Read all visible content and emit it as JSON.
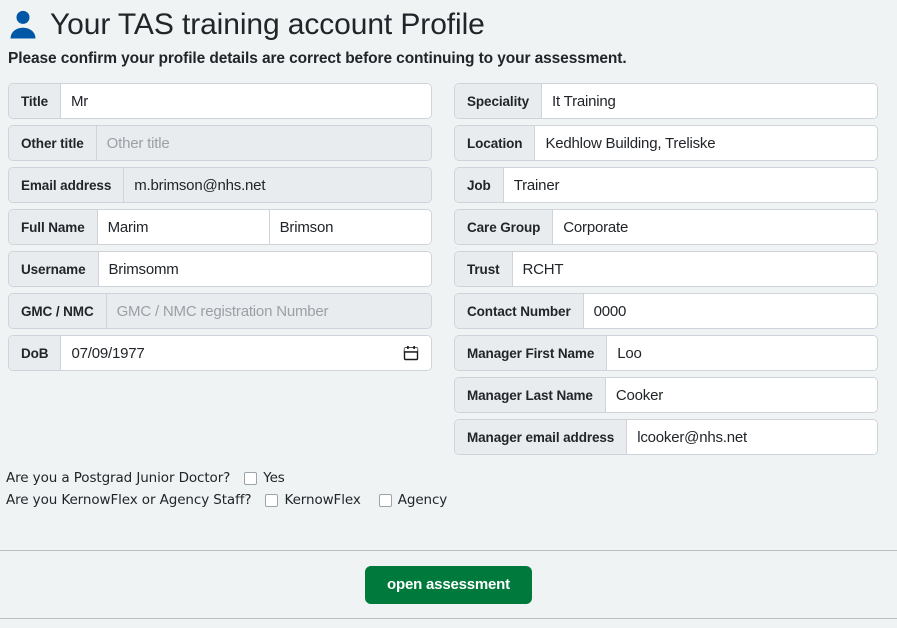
{
  "header": {
    "icon": "person-icon",
    "title": "Your TAS training account Profile",
    "subtitle": "Please confirm your profile details are correct before continuing to your assessment."
  },
  "form": {
    "left_column": [
      {
        "name": "title",
        "label": "Title",
        "value": "Mr",
        "placeholder": "",
        "readonly": false
      },
      {
        "name": "other-title",
        "label": "Other title",
        "value": "",
        "placeholder": "Other title",
        "readonly": true
      },
      {
        "name": "email",
        "label": "Email address",
        "value": "m.brimson@nhs.net",
        "placeholder": "",
        "readonly": true
      },
      {
        "name": "full-name",
        "label": "Full Name",
        "value": "Marim",
        "value2": "Brimson",
        "placeholder": "",
        "readonly": false,
        "split": true
      },
      {
        "name": "username",
        "label": "Username",
        "value": "Brimsomm",
        "placeholder": "",
        "readonly": false
      },
      {
        "name": "gmc-nmc",
        "label": "GMC / NMC",
        "value": "",
        "placeholder": "GMC / NMC registration Number",
        "readonly": true
      },
      {
        "name": "dob",
        "label": "DoB",
        "value": "07/09/1977",
        "placeholder": "",
        "readonly": false,
        "date": true,
        "icon": "calendar-icon"
      }
    ],
    "right_column": [
      {
        "name": "speciality",
        "label": "Speciality",
        "value": "It Training",
        "placeholder": "",
        "readonly": false
      },
      {
        "name": "location",
        "label": "Location",
        "value": "Kedhlow Building, Treliske",
        "placeholder": "",
        "readonly": false
      },
      {
        "name": "job",
        "label": "Job",
        "value": "Trainer",
        "placeholder": "",
        "readonly": false
      },
      {
        "name": "care-group",
        "label": "Care Group",
        "value": "Corporate",
        "placeholder": "",
        "readonly": false
      },
      {
        "name": "trust",
        "label": "Trust",
        "value": "RCHT",
        "placeholder": "",
        "readonly": false
      },
      {
        "name": "contact-number",
        "label": "Contact Number",
        "value": "0000",
        "placeholder": "",
        "readonly": false
      },
      {
        "name": "manager-first-name",
        "label": "Manager First Name",
        "value": "Loo",
        "placeholder": "",
        "readonly": false
      },
      {
        "name": "manager-last-name",
        "label": "Manager Last Name",
        "value": "Cooker",
        "placeholder": "",
        "readonly": false
      },
      {
        "name": "manager-email",
        "label": "Manager email address",
        "value": "lcooker@nhs.net",
        "placeholder": "",
        "readonly": false
      }
    ]
  },
  "checkboxes": {
    "rows": [
      {
        "name": "postgrad-junior-doctor",
        "question": "Are you a Postgrad Junior Doctor?",
        "options": [
          {
            "name": "yes",
            "label": "Yes",
            "checked": false
          }
        ]
      },
      {
        "name": "kernowflex-agency-staff",
        "question": "Are you KernowFlex or Agency Staff?",
        "options": [
          {
            "name": "kernowflex",
            "label": "KernowFlex",
            "checked": false
          },
          {
            "name": "agency",
            "label": "Agency",
            "checked": false
          }
        ]
      }
    ]
  },
  "footer": {
    "open_assessment_label": "open assessment"
  },
  "colors": {
    "page_background": "#eff3f4",
    "label_background": "#e9ecef",
    "field_border": "#ced4da",
    "icon_blue": "#0057a6",
    "button_green": "#00793c",
    "button_text": "#ffffff",
    "placeholder_grey": "#9aa0a6",
    "divider": "#b9c0c4",
    "text": "#212529"
  }
}
